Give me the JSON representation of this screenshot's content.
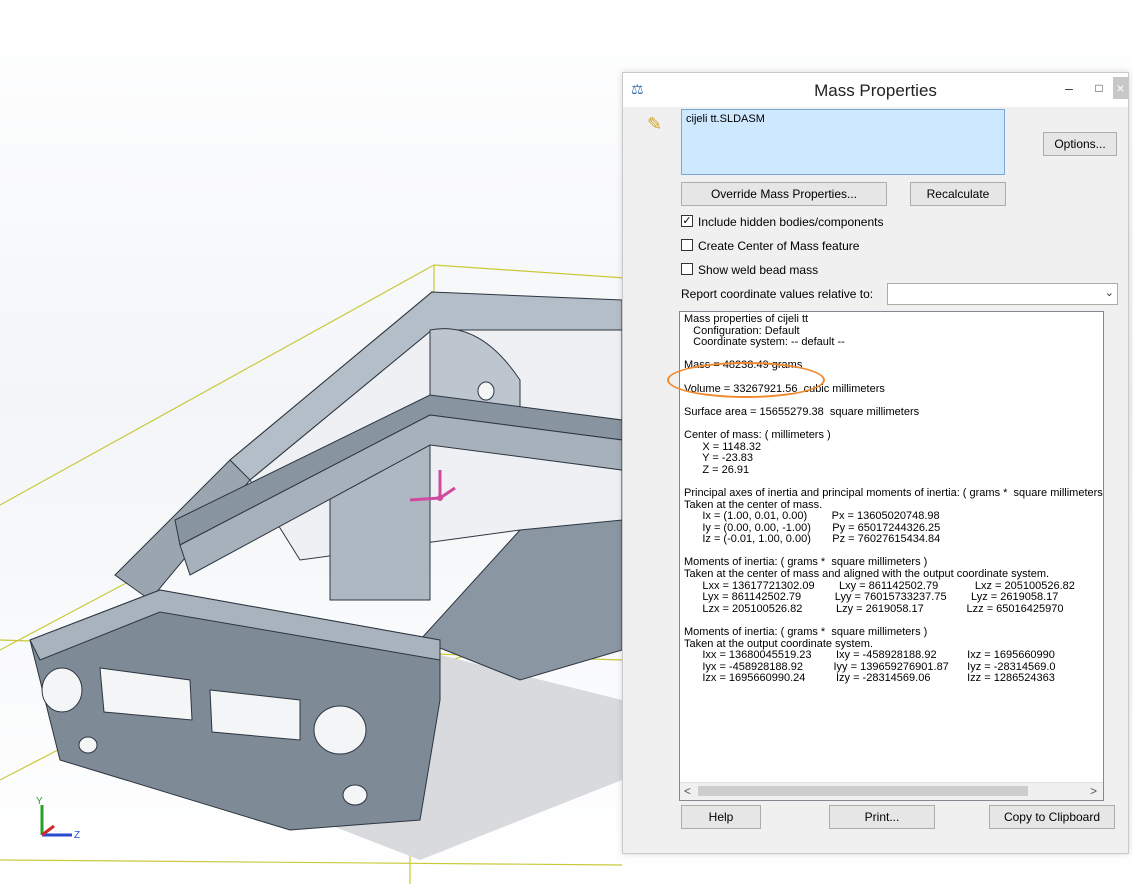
{
  "viewport": {
    "model_color": "#8e9aa6",
    "bbox_color": "#c9c93a",
    "triad_labels": {
      "y": "Y",
      "z": "Z"
    }
  },
  "dialog": {
    "title": "Mass Properties",
    "icons": {
      "app": "scale-icon",
      "part": "assembly-icon"
    },
    "window_buttons": {
      "minimize": "–",
      "maximize": "□",
      "close": "×"
    },
    "selection": "cijeli tt.SLDASM",
    "buttons": {
      "options": "Options...",
      "override": "Override Mass Properties...",
      "recalculate": "Recalculate",
      "help": "Help",
      "print": "Print...",
      "copy": "Copy to Clipboard"
    },
    "checkboxes": [
      {
        "label": "Include hidden bodies/components",
        "checked": true
      },
      {
        "label": "Create Center of Mass feature",
        "checked": false
      },
      {
        "label": "Show weld bead mass",
        "checked": false
      }
    ],
    "report_label": "Report coordinate values relative to:",
    "report_value": "",
    "highlight_color": "#f08a30",
    "results": {
      "header": "Mass properties of cijeli tt",
      "configuration": "   Configuration: Default",
      "coordinate_system": "   Coordinate system: -- default --",
      "mass": "Mass = 48238.49 grams",
      "volume": "Volume = 33267921.56  cubic millimeters",
      "surface_area": "Surface area = 15655279.38  square millimeters",
      "com_header": "Center of mass: ( millimeters )",
      "com_x": "      X = 1148.32",
      "com_y": "      Y = -23.83",
      "com_z": "      Z = 26.91",
      "principal_header": "Principal axes of inertia and principal moments of inertia: ( grams *  square millimeters )",
      "principal_taken": "Taken at the center of mass.",
      "ix": "      Ix = (1.00, 0.01, 0.00)        Px = 13605020748.98",
      "iy": "      Iy = (0.00, 0.00, -1.00)       Py = 65017244326.25",
      "iz": "      Iz = (-0.01, 1.00, 0.00)       Pz = 76027615434.84",
      "moi1_header": "Moments of inertia: ( grams *  square millimeters )",
      "moi1_taken": "Taken at the center of mass and aligned with the output coordinate system.",
      "lxx_row": "      Lxx = 13617721302.09        Lxy = 861142502.79            Lxz = 205100526.82",
      "lyx_row": "      Lyx = 861142502.79           Lyy = 76015733237.75        Lyz = 2619058.17",
      "lzx_row": "      Lzx = 205100526.82           Lzy = 2619058.17              Lzz = 65016425970",
      "moi2_header": "Moments of inertia: ( grams *  square millimeters )",
      "moi2_taken": "Taken at the output coordinate system.",
      "ixx_row": "      Ixx = 13680045519.23        Ixy = -458928188.92          Ixz = 1695660990",
      "iyx_row": "      Iyx = -458928188.92          Iyy = 139659276901.87      Iyz = -28314569.0",
      "izx_row": "      Izx = 1695660990.24          Izy = -28314569.06            Izz = 1286524363"
    },
    "scroll": {
      "left": "<",
      "right": ">"
    }
  }
}
